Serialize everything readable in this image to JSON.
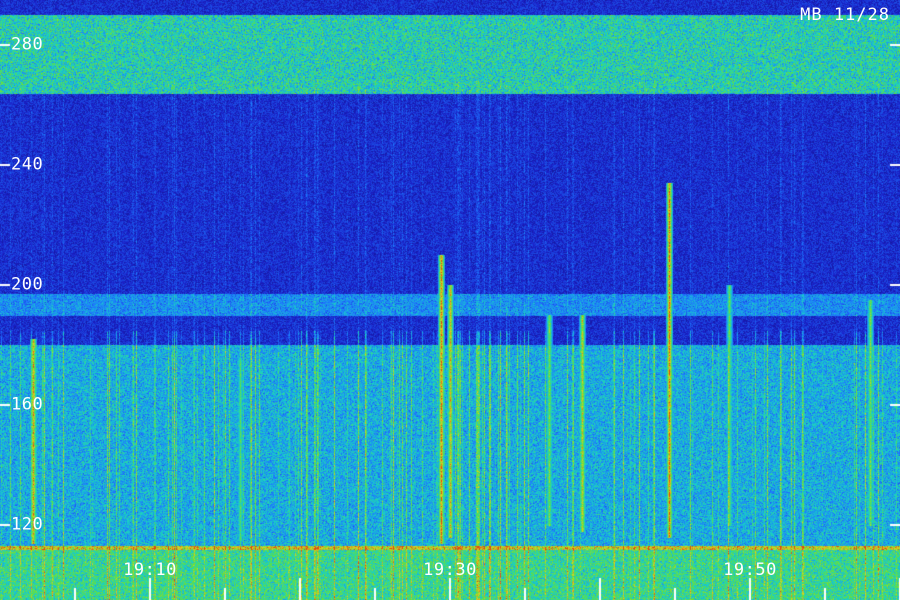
{
  "corner_label": "MB 11/28",
  "chart_data": {
    "type": "heatmap",
    "title": "",
    "xlabel": "",
    "ylabel": "",
    "y_ticks": [
      120,
      160,
      200,
      240,
      280
    ],
    "y_tick_labels": [
      "120",
      "160",
      "200",
      "240",
      "280"
    ],
    "ylim": [
      112,
      294
    ],
    "x_ticks": [
      "19:10",
      "19:30",
      "19:50"
    ],
    "x_tick_minutes": [
      10,
      30,
      50
    ],
    "xlim_minutes": [
      1,
      61
    ],
    "grid": false,
    "colormap": [
      "#0a0640",
      "#1a20c8",
      "#1e78ff",
      "#18d0c8",
      "#60e040",
      "#e0d020",
      "#e04010"
    ],
    "bands": [
      {
        "from": 264,
        "to": 290,
        "intensity": 0.55
      },
      {
        "from": 190,
        "to": 197,
        "intensity": 0.3
      },
      {
        "from": 112,
        "to": 180,
        "intensity": 0.4
      }
    ],
    "bursts": [
      {
        "minute": 2.2,
        "low": 114,
        "high": 182,
        "intensity": 0.85
      },
      {
        "minute": 16.0,
        "low": 115,
        "high": 175,
        "intensity": 0.5
      },
      {
        "minute": 29.4,
        "low": 114,
        "high": 210,
        "intensity": 0.95
      },
      {
        "minute": 30.0,
        "low": 116,
        "high": 200,
        "intensity": 0.8
      },
      {
        "minute": 36.6,
        "low": 120,
        "high": 190,
        "intensity": 0.6
      },
      {
        "minute": 38.8,
        "low": 118,
        "high": 190,
        "intensity": 0.75
      },
      {
        "minute": 44.6,
        "low": 116,
        "high": 234,
        "intensity": 0.95
      },
      {
        "minute": 48.6,
        "low": 120,
        "high": 200,
        "intensity": 0.55
      },
      {
        "minute": 58.0,
        "low": 120,
        "high": 195,
        "intensity": 0.6
      }
    ]
  }
}
